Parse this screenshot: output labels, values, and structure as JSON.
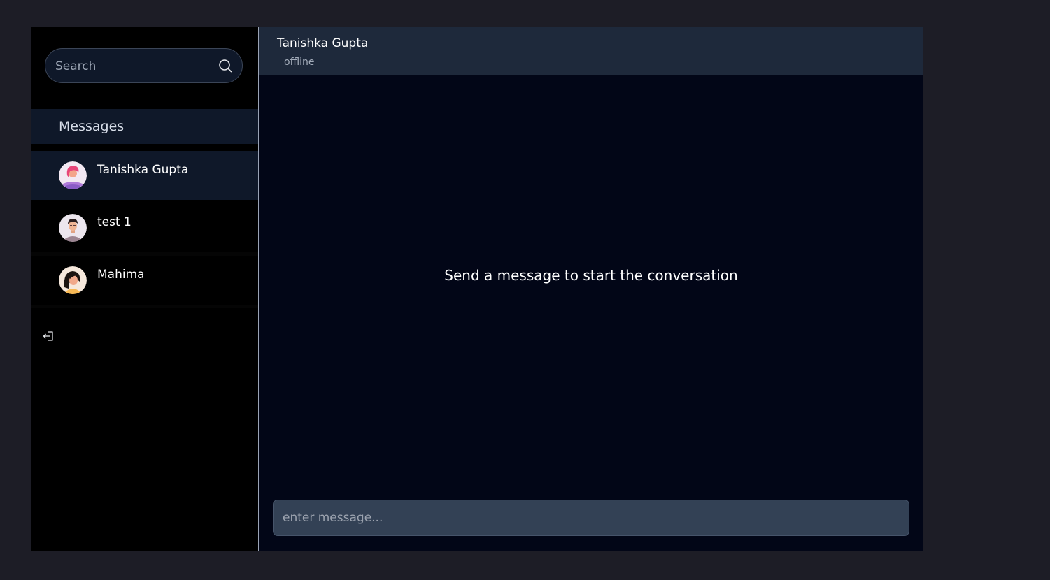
{
  "sidebar": {
    "search": {
      "placeholder": "Search",
      "value": "",
      "icon": "search-icon"
    },
    "messages_label": "Messages",
    "contacts": [
      {
        "name": "Tanishka Gupta",
        "avatar": "avatar-woman-pink-hair",
        "active": true
      },
      {
        "name": "test 1",
        "avatar": "avatar-man-dark-hair",
        "active": false
      },
      {
        "name": "Mahima",
        "avatar": "avatar-woman-black-hair",
        "active": false
      }
    ],
    "logout_icon": "logout-icon"
  },
  "chat": {
    "header": {
      "name": "Tanishka Gupta",
      "status": "offline"
    },
    "empty_state": "Send a message to start the conversation",
    "input": {
      "placeholder": "enter message...",
      "value": ""
    }
  },
  "colors": {
    "page_bg": "#1d1d26",
    "sidebar_bg": "#000000",
    "panel_highlight": "#0f1829",
    "chat_bg": "#020617",
    "chat_header_bg": "#1e293b",
    "input_bg": "#334155"
  }
}
